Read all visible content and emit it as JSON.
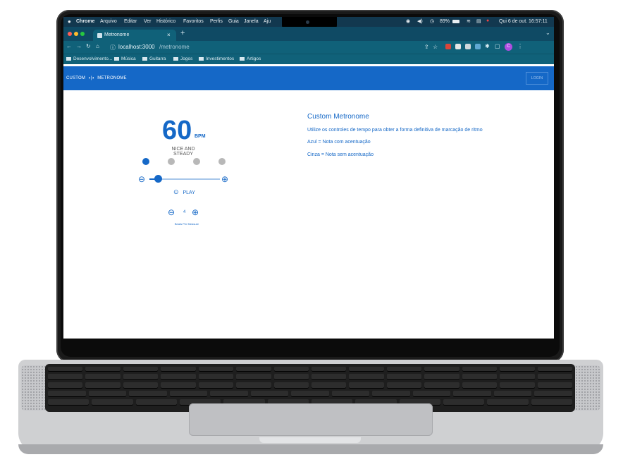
{
  "menubar": {
    "apple_icon": "apple-icon",
    "items": [
      "Chrome",
      "Arquivo",
      "Editar",
      "Ver",
      "Histórico",
      "Favoritos",
      "Perfis",
      "Guia",
      "Janela",
      "Aju"
    ],
    "battery": "89%",
    "datetime": "Qui 6 de out. 16:57:11"
  },
  "browser": {
    "tab_title": "Metronome",
    "url_host": "localhost:3000",
    "url_path": "/metronome",
    "bookmarks": [
      "Desenvolvimento...",
      "Música",
      "Guitarra",
      "Jogos",
      "Investimentos",
      "Artigos"
    ],
    "profile_letter": "C"
  },
  "app": {
    "logo_left": "CUSTOM",
    "logo_right": "METRONOME",
    "login_label": "LOGIN"
  },
  "metronome": {
    "bpm": "60",
    "bpm_unit": "BPM",
    "tempo_name": "NICE AND STEADY",
    "beats": [
      true,
      false,
      false,
      false
    ],
    "slider_level_fraction": 0.12,
    "play_label": "PLAY",
    "beats_per_measure": "4",
    "beats_per_measure_label": "Beats Per Measure"
  },
  "info": {
    "title": "Custom Metronome",
    "line1": "Utilize os controles de tempo para obter a forma definitiva de marcação de ritmo",
    "line2": "Azul = Nota com acentuação",
    "line3": "Cinza = Nota sem acentuação"
  },
  "colors": {
    "accent": "#1568c7",
    "beat_inactive": "#b8b8b8",
    "menubar": "#12384f",
    "tabbar": "#0f4a64",
    "toolbar": "#106179"
  }
}
